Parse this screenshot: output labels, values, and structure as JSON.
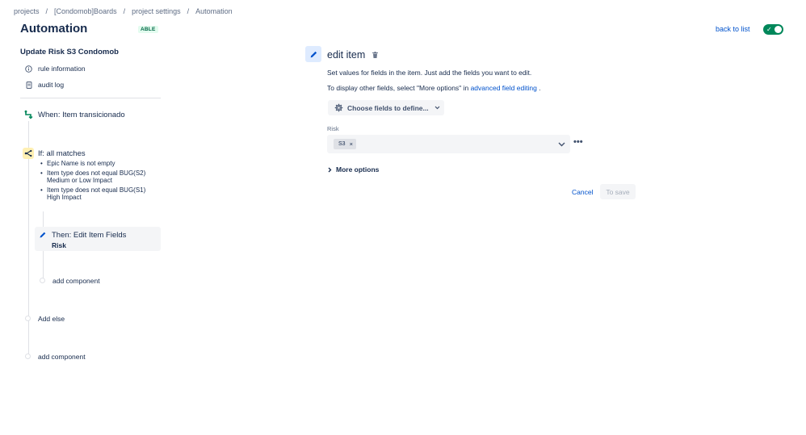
{
  "breadcrumb": [
    {
      "label": "projects"
    },
    {
      "label": "[Condomob]Boards"
    },
    {
      "label": "project settings"
    },
    {
      "label": "Automation"
    }
  ],
  "breadcrumb_separator": "/",
  "header": {
    "title": "Automation",
    "status": "ABLE",
    "back_link": "back to list",
    "toggle_on": true
  },
  "sidebar": {
    "rule_name": "Update Risk S3 Condomob",
    "links": [
      {
        "label": "rule information",
        "icon": "info-icon"
      },
      {
        "label": "audit log",
        "icon": "document-icon"
      }
    ]
  },
  "flow": {
    "trigger": {
      "label": "When: Item transicionado",
      "icon": "transition-icon"
    },
    "condition": {
      "label": "If: all matches",
      "icon": "branch-icon",
      "items": [
        "Epic Name is not empty",
        "Item type does not equal BUG(S2) Medium or Low Impact",
        "Item type does not equal BUG(S1) High Impact"
      ]
    },
    "action": {
      "label": "Then: Edit Item Fields",
      "sub": "Risk",
      "icon": "pencil-icon"
    },
    "add_component_inner": "add component",
    "add_else": "Add else",
    "add_component_outer": "add component"
  },
  "editor": {
    "title": "edit item",
    "desc1": "Set values for fields in the item. Just add the fields you want to edit.",
    "desc2_prefix": "To display other fields, select \"More options\" in",
    "desc2_link": "advanced field editing",
    "desc2_suffix": ".",
    "choose_fields": "Choose fields to define...",
    "field_label": "Risk",
    "selected_value": "S3",
    "more_options": "More options",
    "cancel": "Cancel",
    "save": "To save"
  },
  "colors": {
    "accent": "#0052cc",
    "toggle": "#00875a",
    "trigger_icon": "#00875a",
    "condition_icon_bg": "#fff0b3"
  }
}
